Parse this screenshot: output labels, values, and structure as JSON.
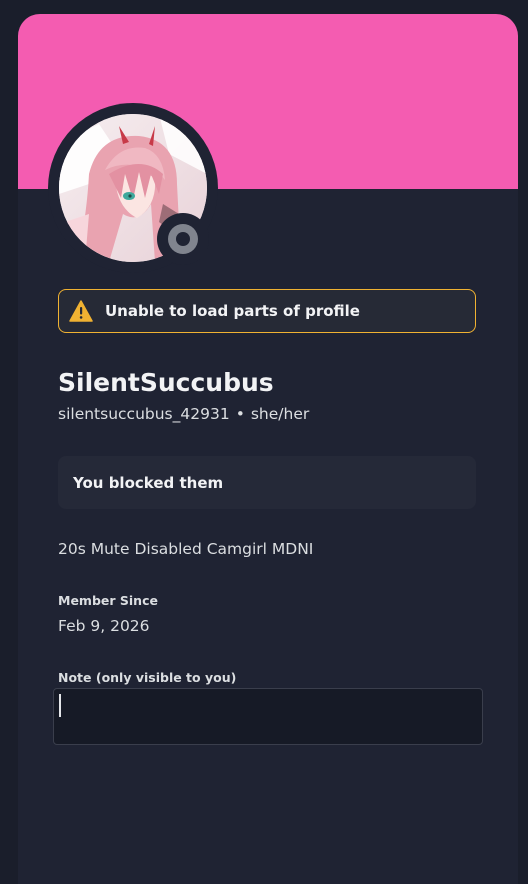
{
  "colors": {
    "banner": "#f45cb1",
    "background": "#1f2333",
    "warning_border": "#f0b232",
    "status_offline": "#80848e"
  },
  "profile": {
    "avatar_icon": "anime-character-avatar",
    "status": "offline",
    "display_name": "SilentSuccubus",
    "username": "silentsuccubus_42931",
    "separator": "•",
    "pronouns": "she/her",
    "bio": "20s Mute Disabled Camgirl MDNI"
  },
  "warning": {
    "icon": "warning-icon",
    "text": "Unable to load parts of profile"
  },
  "blocked": {
    "text": "You blocked them"
  },
  "member_since": {
    "label": "Member Since",
    "date": "Feb 9, 2026"
  },
  "note": {
    "label": "Note (only visible to you)",
    "value": ""
  }
}
